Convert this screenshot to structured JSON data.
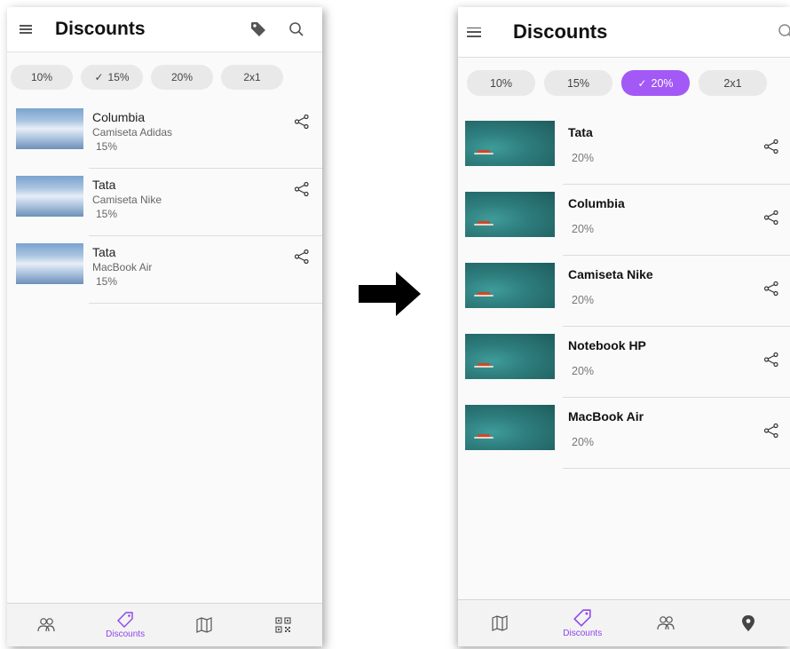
{
  "left_screen": {
    "app_title": "Discounts",
    "filters": [
      {
        "label": "10%",
        "selected": false
      },
      {
        "label": "15%",
        "selected": true
      },
      {
        "label": "20%",
        "selected": false
      },
      {
        "label": "2x1",
        "selected": false
      }
    ],
    "items": [
      {
        "title": "Columbia",
        "subtitle": "Camiseta Adidas",
        "discount": "15%"
      },
      {
        "title": "Tata",
        "subtitle": "Camiseta Nike",
        "discount": "15%"
      },
      {
        "title": "Tata",
        "subtitle": "MacBook Air",
        "discount": "15%"
      }
    ],
    "nav": {
      "active_label": "Discounts"
    }
  },
  "right_screen": {
    "app_title": "Discounts",
    "filters": [
      {
        "label": "10%",
        "selected": false
      },
      {
        "label": "15%",
        "selected": false
      },
      {
        "label": "20%",
        "selected": true
      },
      {
        "label": "2x1",
        "selected": false
      }
    ],
    "items": [
      {
        "title": "Tata",
        "discount": "20%"
      },
      {
        "title": "Columbia",
        "discount": "20%"
      },
      {
        "title": "Camiseta Nike",
        "discount": "20%"
      },
      {
        "title": "Notebook HP",
        "discount": "20%"
      },
      {
        "title": "MacBook Air",
        "discount": "20%"
      }
    ],
    "nav": {
      "active_label": "Discounts"
    }
  },
  "colors": {
    "accent": "#a259f5",
    "nav_active": "#8e44ec",
    "chip_bg": "#e9e9e9"
  }
}
